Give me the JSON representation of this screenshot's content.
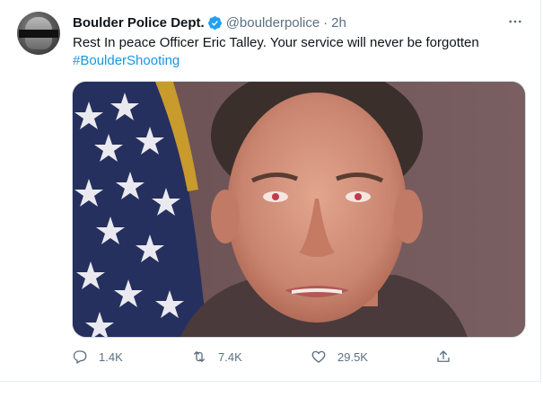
{
  "tweet": {
    "author": {
      "name": "Boulder Police Dept.",
      "handle": "@boulderpolice",
      "verified": true
    },
    "separator": "·",
    "time": "2h",
    "text": "Rest In peace Officer Eric Talley. Your service will never be forgotten",
    "hashtag": "#BoulderShooting",
    "media": {
      "description": "Portrait photo of Officer Eric Talley in front of an American flag"
    },
    "stats": {
      "replies": "1.4K",
      "retweets": "7.4K",
      "likes": "29.5K"
    }
  },
  "colors": {
    "link": "#1b95e0",
    "secondary_text": "#5b7083",
    "verified": "#1da1f2"
  },
  "icons": {
    "more": "more-horizontal-icon",
    "reply": "reply-icon",
    "retweet": "retweet-icon",
    "like": "heart-icon",
    "share": "share-icon",
    "verified": "verified-badge-icon"
  }
}
